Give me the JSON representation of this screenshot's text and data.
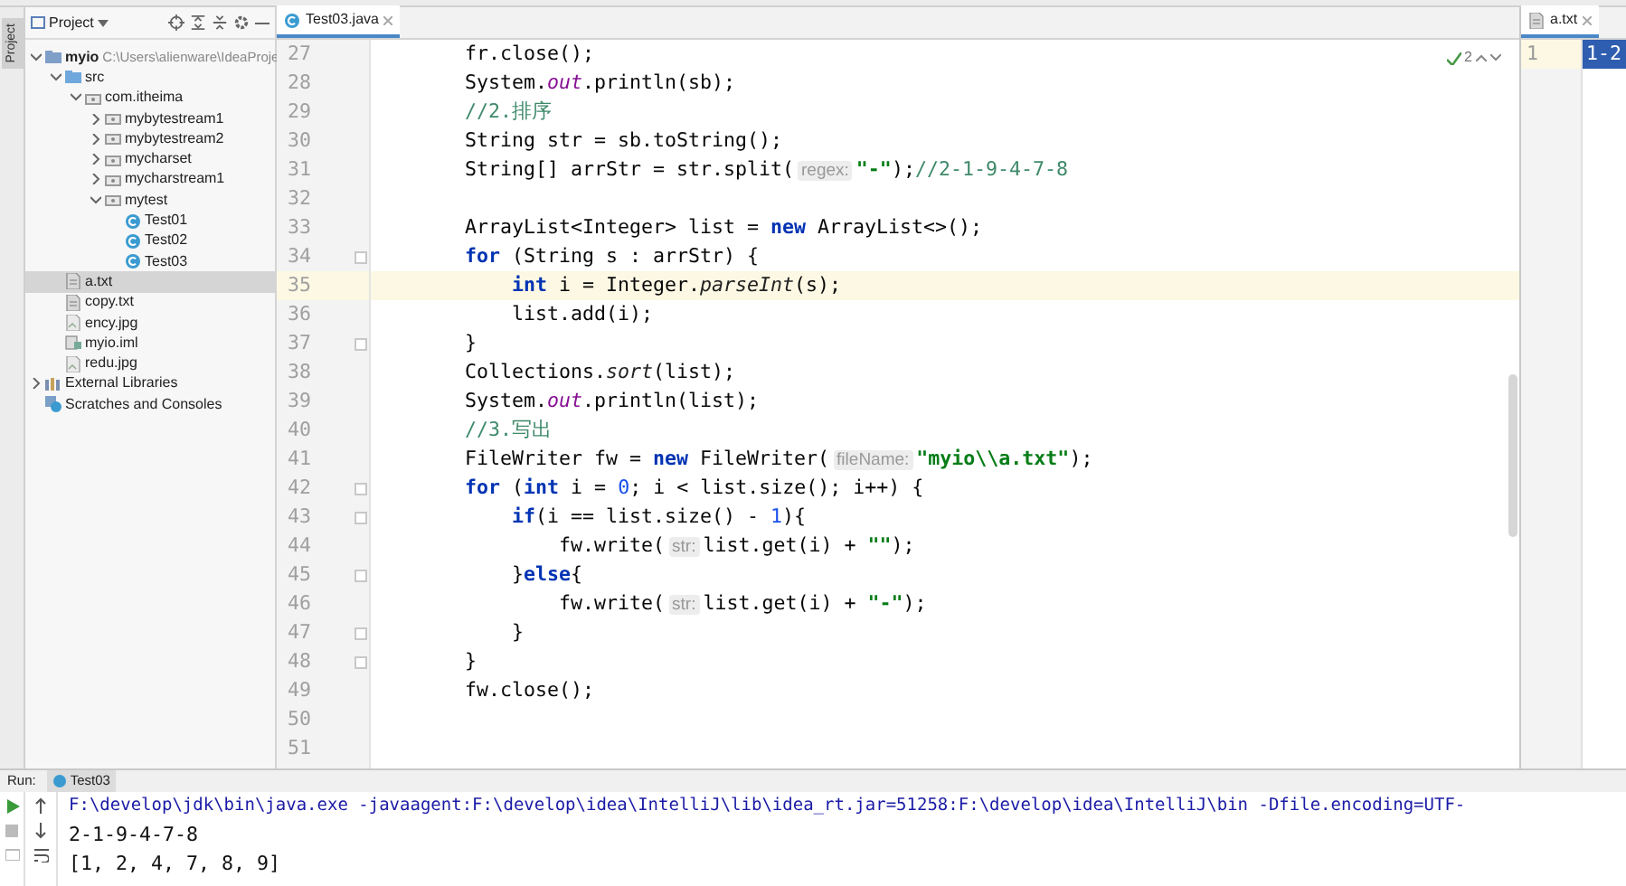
{
  "side_stripe": {
    "label": "Project"
  },
  "project_panel": {
    "title": "Project",
    "tree": [
      {
        "label": "myio",
        "path": "C:\\Users\\alienware\\IdeaProje",
        "kind": "module",
        "expanded": true,
        "selected": false,
        "children": [
          {
            "label": "src",
            "kind": "folder",
            "expanded": true,
            "selected": false,
            "children": [
              {
                "label": "com.itheima",
                "kind": "package",
                "expanded": true,
                "selected": false,
                "children": [
                  {
                    "label": "mybytestream1",
                    "kind": "package",
                    "expanded": false,
                    "selected": false
                  },
                  {
                    "label": "mybytestream2",
                    "kind": "package",
                    "expanded": false,
                    "selected": false
                  },
                  {
                    "label": "mycharset",
                    "kind": "package",
                    "expanded": false,
                    "selected": false
                  },
                  {
                    "label": "mycharstream1",
                    "kind": "package",
                    "expanded": false,
                    "selected": false
                  },
                  {
                    "label": "mytest",
                    "kind": "package",
                    "expanded": true,
                    "selected": false,
                    "children": [
                      {
                        "label": "Test01",
                        "kind": "class",
                        "selected": false
                      },
                      {
                        "label": "Test02",
                        "kind": "class",
                        "selected": false
                      },
                      {
                        "label": "Test03",
                        "kind": "class",
                        "selected": false
                      }
                    ]
                  }
                ]
              }
            ]
          },
          {
            "label": "a.txt",
            "kind": "file",
            "selected": true
          },
          {
            "label": "copy.txt",
            "kind": "file",
            "selected": false
          },
          {
            "label": "ency.jpg",
            "kind": "image",
            "selected": false
          },
          {
            "label": "myio.iml",
            "kind": "iml",
            "selected": false
          },
          {
            "label": "redu.jpg",
            "kind": "image",
            "selected": false
          }
        ]
      },
      {
        "label": "External Libraries",
        "kind": "library",
        "expanded": false,
        "selected": false
      },
      {
        "label": "Scratches and Consoles",
        "kind": "scratches",
        "selected": false
      }
    ]
  },
  "editor": {
    "tab": {
      "label": "Test03.java",
      "selected": true
    },
    "inspection_count": "2",
    "lines": [
      {
        "num": "27",
        "current": false,
        "fold": false,
        "segments": [
          {
            "kind": "plain",
            "text": "        fr.close();"
          }
        ]
      },
      {
        "num": "28",
        "current": false,
        "fold": false,
        "segments": [
          {
            "kind": "plain",
            "text": "        System."
          },
          {
            "kind": "static",
            "text": "out"
          },
          {
            "kind": "plain",
            "text": ".println(sb);"
          }
        ]
      },
      {
        "num": "29",
        "current": false,
        "fold": false,
        "segments": [
          {
            "kind": "comment",
            "text": "        //2.排序"
          }
        ]
      },
      {
        "num": "30",
        "current": false,
        "fold": false,
        "segments": [
          {
            "kind": "plain",
            "text": "        String str = sb.toString();"
          }
        ]
      },
      {
        "num": "31",
        "current": false,
        "fold": false,
        "segments": [
          {
            "kind": "plain",
            "text": "        String[] arrStr = str.split("
          },
          {
            "kind": "hint",
            "text": "regex:"
          },
          {
            "kind": "str",
            "text": "\"-\""
          },
          {
            "kind": "plain",
            "text": ");"
          },
          {
            "kind": "comment",
            "text": "//2-1-9-4-7-8"
          }
        ]
      },
      {
        "num": "32",
        "current": false,
        "fold": false
      },
      {
        "num": "33",
        "current": false,
        "fold": false,
        "segments": [
          {
            "kind": "plain",
            "text": "        ArrayList<Integer> list = "
          },
          {
            "kind": "kw",
            "text": "new"
          },
          {
            "kind": "plain",
            "text": " ArrayList<>();"
          }
        ]
      },
      {
        "num": "34",
        "current": false,
        "fold": true,
        "segments": [
          {
            "kind": "kw",
            "text": "        for"
          },
          {
            "kind": "plain",
            "text": " (String s : arrStr) {"
          }
        ]
      },
      {
        "num": "35",
        "current": true,
        "fold": false,
        "segments": [
          {
            "kind": "kw",
            "text": "            int"
          },
          {
            "kind": "plain",
            "text": " i = Integer."
          },
          {
            "kind": "italic",
            "text": "parseInt"
          },
          {
            "kind": "plain",
            "text": "(s);"
          }
        ]
      },
      {
        "num": "36",
        "current": false,
        "fold": false,
        "segments": [
          {
            "kind": "plain",
            "text": "            list.add(i);"
          }
        ]
      },
      {
        "num": "37",
        "current": false,
        "fold": true,
        "segments": [
          {
            "kind": "plain",
            "text": "        }"
          }
        ]
      },
      {
        "num": "38",
        "current": false,
        "fold": false,
        "segments": [
          {
            "kind": "plain",
            "text": "        Collections."
          },
          {
            "kind": "italic",
            "text": "sort"
          },
          {
            "kind": "plain",
            "text": "(list);"
          }
        ]
      },
      {
        "num": "39",
        "current": false,
        "fold": false,
        "segments": [
          {
            "kind": "plain",
            "text": "        System."
          },
          {
            "kind": "static",
            "text": "out"
          },
          {
            "kind": "plain",
            "text": ".println(list);"
          }
        ]
      },
      {
        "num": "40",
        "current": false,
        "fold": false,
        "segments": [
          {
            "kind": "comment",
            "text": "        //3.写出"
          }
        ]
      },
      {
        "num": "41",
        "current": false,
        "fold": false,
        "segments": [
          {
            "kind": "plain",
            "text": "        FileWriter fw = "
          },
          {
            "kind": "kw",
            "text": "new"
          },
          {
            "kind": "plain",
            "text": " FileWriter("
          },
          {
            "kind": "hint",
            "text": "fileName:"
          },
          {
            "kind": "str",
            "text": "\"myio\\\\a.txt\""
          },
          {
            "kind": "plain",
            "text": ");"
          }
        ]
      },
      {
        "num": "42",
        "current": false,
        "fold": true,
        "segments": [
          {
            "kind": "kw",
            "text": "        for"
          },
          {
            "kind": "plain",
            "text": " ("
          },
          {
            "kind": "kw",
            "text": "int"
          },
          {
            "kind": "plain",
            "text": " i = "
          },
          {
            "kind": "num",
            "text": "0"
          },
          {
            "kind": "plain",
            "text": "; i < list.size(); i++) {"
          }
        ]
      },
      {
        "num": "43",
        "current": false,
        "fold": true,
        "segments": [
          {
            "kind": "kw",
            "text": "            if"
          },
          {
            "kind": "plain",
            "text": "(i == list.size() - "
          },
          {
            "kind": "num",
            "text": "1"
          },
          {
            "kind": "plain",
            "text": "){"
          }
        ]
      },
      {
        "num": "44",
        "current": false,
        "fold": false,
        "segments": [
          {
            "kind": "plain",
            "text": "                fw.write("
          },
          {
            "kind": "hint",
            "text": "str:"
          },
          {
            "kind": "plain",
            "text": "list.get(i) + "
          },
          {
            "kind": "str",
            "text": "\"\""
          },
          {
            "kind": "plain",
            "text": ");"
          }
        ]
      },
      {
        "num": "45",
        "current": false,
        "fold": true,
        "segments": [
          {
            "kind": "plain",
            "text": "            }"
          },
          {
            "kind": "kw",
            "text": "else"
          },
          {
            "kind": "plain",
            "text": "{"
          }
        ]
      },
      {
        "num": "46",
        "current": false,
        "fold": false,
        "segments": [
          {
            "kind": "plain",
            "text": "                fw.write("
          },
          {
            "kind": "hint",
            "text": "str:"
          },
          {
            "kind": "plain",
            "text": "list.get(i) + "
          },
          {
            "kind": "str",
            "text": "\"-\""
          },
          {
            "kind": "plain",
            "text": ");"
          }
        ]
      },
      {
        "num": "47",
        "current": false,
        "fold": true,
        "segments": [
          {
            "kind": "plain",
            "text": "            }"
          }
        ]
      },
      {
        "num": "48",
        "current": false,
        "fold": true,
        "segments": [
          {
            "kind": "plain",
            "text": "        }"
          }
        ]
      },
      {
        "num": "49",
        "current": false,
        "fold": false,
        "segments": [
          {
            "kind": "plain",
            "text": "        fw.close();"
          }
        ]
      },
      {
        "num": "50",
        "current": false,
        "fold": false
      },
      {
        "num": "51",
        "current": false,
        "fold": false
      }
    ]
  },
  "side_editor": {
    "tab": {
      "label": "a.txt",
      "selected": true
    },
    "line_number": "1",
    "text": "1-2"
  },
  "run_panel": {
    "label": "Run:",
    "tab": {
      "label": "Test03",
      "selected": true
    },
    "output": [
      "F:\\develop\\jdk\\bin\\java.exe -javaagent:F:\\develop\\idea\\IntelliJ\\lib\\idea_rt.jar=51258:F:\\develop\\idea\\IntelliJ\\bin -Dfile.encoding=UTF-",
      "2-1-9-4-7-8",
      "[1, 2, 4, 7, 8, 9]"
    ]
  }
}
